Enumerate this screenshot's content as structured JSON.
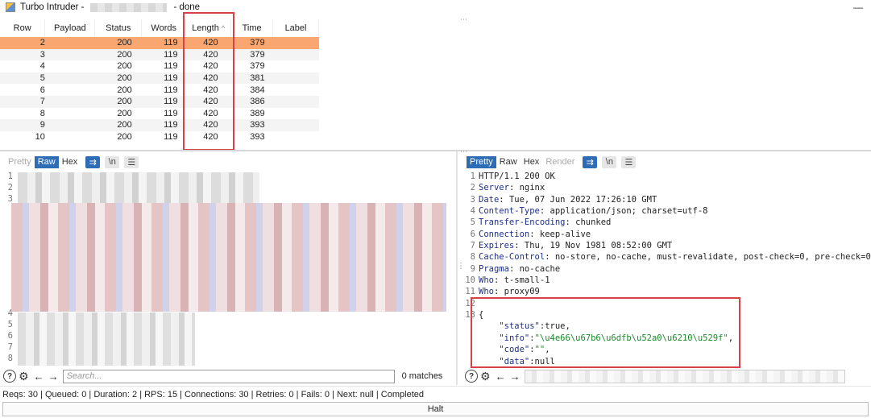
{
  "window": {
    "title_prefix": "Turbo Intruder -",
    "title_suffix": "- done",
    "minimize_glyph": "—"
  },
  "results": {
    "columns": [
      "Row",
      "Payload",
      "Status",
      "Words",
      "Length",
      "Time",
      "Label"
    ],
    "sort_indicator": "^",
    "rows": [
      {
        "row": "2",
        "payload": "",
        "status": "200",
        "words": "119",
        "length": "420",
        "time": "379",
        "label": "",
        "selected": true
      },
      {
        "row": "3",
        "payload": "",
        "status": "200",
        "words": "119",
        "length": "420",
        "time": "379",
        "label": ""
      },
      {
        "row": "4",
        "payload": "",
        "status": "200",
        "words": "119",
        "length": "420",
        "time": "379",
        "label": ""
      },
      {
        "row": "5",
        "payload": "",
        "status": "200",
        "words": "119",
        "length": "420",
        "time": "381",
        "label": ""
      },
      {
        "row": "6",
        "payload": "",
        "status": "200",
        "words": "119",
        "length": "420",
        "time": "384",
        "label": ""
      },
      {
        "row": "7",
        "payload": "",
        "status": "200",
        "words": "119",
        "length": "420",
        "time": "386",
        "label": ""
      },
      {
        "row": "8",
        "payload": "",
        "status": "200",
        "words": "119",
        "length": "420",
        "time": "389",
        "label": ""
      },
      {
        "row": "9",
        "payload": "",
        "status": "200",
        "words": "119",
        "length": "420",
        "time": "393",
        "label": ""
      },
      {
        "row": "10",
        "payload": "",
        "status": "200",
        "words": "119",
        "length": "420",
        "time": "393",
        "label": ""
      }
    ]
  },
  "request_panel": {
    "tabs": [
      "Pretty",
      "Raw",
      "Hex"
    ],
    "active_tab": "Raw",
    "btn_wrap": "⇉",
    "btn_newline": "\\n",
    "btn_menu": "☰",
    "line_numbers": [
      "1",
      "2",
      "3",
      "4",
      "5",
      "6",
      "7",
      "8"
    ]
  },
  "response_panel": {
    "tabs": [
      "Pretty",
      "Raw",
      "Hex",
      "Render"
    ],
    "active_tab": "Pretty",
    "btn_wrap": "⇉",
    "btn_newline": "\\n",
    "btn_menu": "☰",
    "status_line": "HTTP/1.1 200 OK",
    "headers": [
      {
        "name": "Server",
        "value": " nginx"
      },
      {
        "name": "Date",
        "value": " Tue, 07 Jun 2022 17:26:10 GMT"
      },
      {
        "name": "Content-Type",
        "value": " application/json; charset=utf-8"
      },
      {
        "name": "Transfer-Encoding",
        "value": " chunked"
      },
      {
        "name": "Connection",
        "value": " keep-alive"
      },
      {
        "name": "Expires",
        "value": " Thu, 19 Nov 1981 08:52:00 GMT"
      },
      {
        "name": "Cache-Control",
        "value": " no-store, no-cache, must-revalidate, post-check=0, pre-check=0"
      },
      {
        "name": "Pragma",
        "value": " no-cache"
      },
      {
        "name": "Who",
        "value": " t-small-1"
      },
      {
        "name": "Who",
        "value": " proxy09"
      }
    ],
    "body_open": "{",
    "json": {
      "status_key": "\"status\"",
      "status_val": ":true,",
      "info_key": "\"info\"",
      "info_colon": ":",
      "info_val": "\"\\u4e66\\u67b6\\u6dfb\\u52a0\\u6210\\u529f\"",
      "info_comma": ",",
      "code_key": "\"code\"",
      "code_colon": ":",
      "code_val": "\"\"",
      "code_comma": ",",
      "data_key": "\"data\"",
      "data_val": ":null"
    }
  },
  "search_left": {
    "help_glyph": "?",
    "settings_glyph": "⚙",
    "prev_glyph": "←",
    "next_glyph": "→",
    "placeholder": "Search...",
    "matches": "0 matches"
  },
  "search_right": {
    "help_glyph": "?",
    "settings_glyph": "⚙",
    "prev_glyph": "←",
    "next_glyph": "→"
  },
  "statusbar": {
    "text": "Reqs: 30 | Queued: 0 | Duration: 2 | RPS: 15 | Connections: 30 | Retries: 0 | Fails: 0 | Next: null | Completed"
  },
  "halt_button": {
    "label": "Halt"
  },
  "colors": {
    "selection": "#f9a670",
    "accent": "#2e6cb5",
    "highlight_box": "#d9414a",
    "json_string": "#1a8a2a",
    "header_name": "#1d2f8a"
  }
}
